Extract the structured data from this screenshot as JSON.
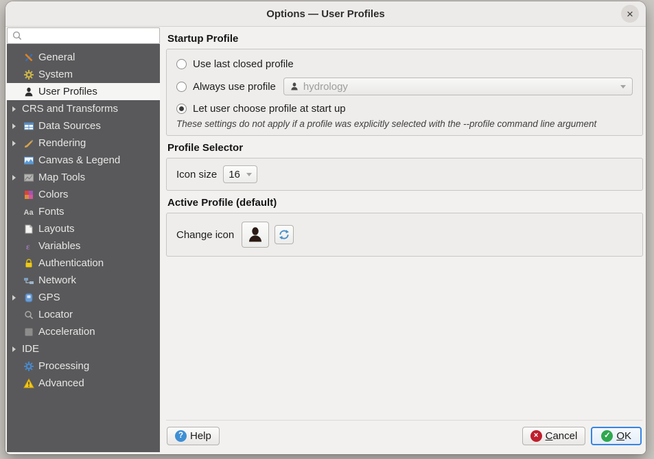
{
  "window": {
    "title": "Options — User Profiles",
    "close_glyph": "×"
  },
  "sidebar": {
    "search": {
      "value": "",
      "placeholder": ""
    },
    "items": [
      {
        "label": "General",
        "icon": "general-icon",
        "expandable": false,
        "selected": false
      },
      {
        "label": "System",
        "icon": "system-icon",
        "expandable": false,
        "selected": false
      },
      {
        "label": "User Profiles",
        "icon": "user-profiles-icon",
        "expandable": false,
        "selected": true
      },
      {
        "label": "CRS and Transforms",
        "icon": null,
        "expandable": true,
        "selected": false
      },
      {
        "label": "Data Sources",
        "icon": "data-sources-icon",
        "expandable": true,
        "selected": false
      },
      {
        "label": "Rendering",
        "icon": "rendering-icon",
        "expandable": true,
        "selected": false
      },
      {
        "label": "Canvas & Legend",
        "icon": "canvas-legend-icon",
        "expandable": false,
        "selected": false
      },
      {
        "label": "Map Tools",
        "icon": "map-tools-icon",
        "expandable": true,
        "selected": false
      },
      {
        "label": "Colors",
        "icon": "colors-icon",
        "expandable": false,
        "selected": false
      },
      {
        "label": "Fonts",
        "icon": "fonts-icon",
        "expandable": false,
        "selected": false
      },
      {
        "label": "Layouts",
        "icon": "layouts-icon",
        "expandable": false,
        "selected": false
      },
      {
        "label": "Variables",
        "icon": "variables-icon",
        "expandable": false,
        "selected": false
      },
      {
        "label": "Authentication",
        "icon": "authentication-icon",
        "expandable": false,
        "selected": false
      },
      {
        "label": "Network",
        "icon": "network-icon",
        "expandable": false,
        "selected": false
      },
      {
        "label": "GPS",
        "icon": "gps-icon",
        "expandable": true,
        "selected": false
      },
      {
        "label": "Locator",
        "icon": "locator-icon",
        "expandable": false,
        "selected": false
      },
      {
        "label": "Acceleration",
        "icon": "acceleration-icon",
        "expandable": false,
        "selected": false
      },
      {
        "label": "IDE",
        "icon": null,
        "expandable": true,
        "selected": false
      },
      {
        "label": "Processing",
        "icon": "processing-icon",
        "expandable": false,
        "selected": false
      },
      {
        "label": "Advanced",
        "icon": "advanced-icon",
        "expandable": false,
        "selected": false
      }
    ]
  },
  "main": {
    "startup_profile": {
      "heading": "Startup Profile",
      "options": [
        {
          "label": "Use last closed profile",
          "selected": false
        },
        {
          "label": "Always use profile",
          "selected": false
        },
        {
          "label": "Let user choose profile at start up",
          "selected": true
        }
      ],
      "profile_combo": {
        "value": "hydrology",
        "enabled": false,
        "icon": "profile-person-icon"
      },
      "note": "These settings do not apply if a profile was explicitly selected with the --profile command line argument"
    },
    "profile_selector": {
      "heading": "Profile Selector",
      "icon_size_label": "Icon size",
      "icon_size_value": "16"
    },
    "active_profile": {
      "heading": "Active Profile (default)",
      "change_icon_label": "Change icon",
      "avatar_icon": "profile-avatar-icon",
      "refresh_icon": "refresh-icon"
    }
  },
  "footer": {
    "help_label": "Help",
    "cancel_label": "Cancel",
    "ok_label": "OK",
    "help_icon_glyph": "?",
    "cancel_icon_glyph": "×",
    "ok_icon_glyph": "✓"
  },
  "colors": {
    "sidebar_bg": "#59595b",
    "selection_bg": "#f5f5f4",
    "accent_focus_blue": "#3584e4",
    "help_icon_blue": "#3f8fd4",
    "cancel_icon_red": "#bf1f2d",
    "ok_icon_green": "#2fa84f",
    "refresh_blue": "#4a90c8",
    "warning_yellow": "#f3c71c",
    "lock_yellow": "#efca13"
  }
}
